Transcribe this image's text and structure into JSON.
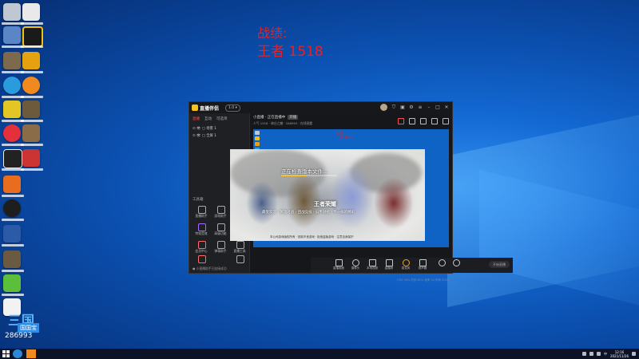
{
  "overlay": {
    "title": "战绩:",
    "score": "王者 1518"
  },
  "watermark": {
    "logo": "三国",
    "sub": "国国宝",
    "number": "286993"
  },
  "app": {
    "name": "直播伴侣",
    "version_badge": "1.0 ▾",
    "tabs": [
      "直播",
      "互动",
      "可选项"
    ],
    "scenes": [
      "⊙ 👁 ▢ 场景 1",
      "⊙ 👁 ▢ 全屏 1"
    ],
    "tools_title": "工具箱",
    "tools": [
      "直播助手",
      "游戏助手",
      "特效音效",
      "高级功能",
      "会员中心",
      "弹幕助手",
      "直播工具",
      "更多工具"
    ],
    "left_status": "● 小直播助手已连接成功",
    "room_title": "小直播 · 正在直播中",
    "room_badge": "开播",
    "room_info": "人气 1518 · 峡谷之巅 · 286993 · 在线观看",
    "preview": {
      "title": "战绩:",
      "score": "王者 1518"
    },
    "loader": {
      "loading_text": "正在检查版本文件...",
      "progress": 0.45,
      "game_logo": "王者荣耀",
      "tagline": "最受欢迎 · 英雄对战 · 团战竞技 · 公平对抗 · 不一样的精彩",
      "footer": "本公司游戏版权所有 · 抵制不良游戏 · 拒绝盗版游戏 · 注意自我保护"
    },
    "bottom_buttons": [
      "直播画面",
      "摄像头",
      "本地视频",
      "直播间",
      "麦克风",
      "扬声器"
    ],
    "start_live": "开始直播",
    "status_line": "CPU 36%   内存 62%   帧率 30   码率 2500"
  },
  "taskbar": {
    "time": "12:16",
    "date": "2021/11/26",
    "lang": "中"
  }
}
